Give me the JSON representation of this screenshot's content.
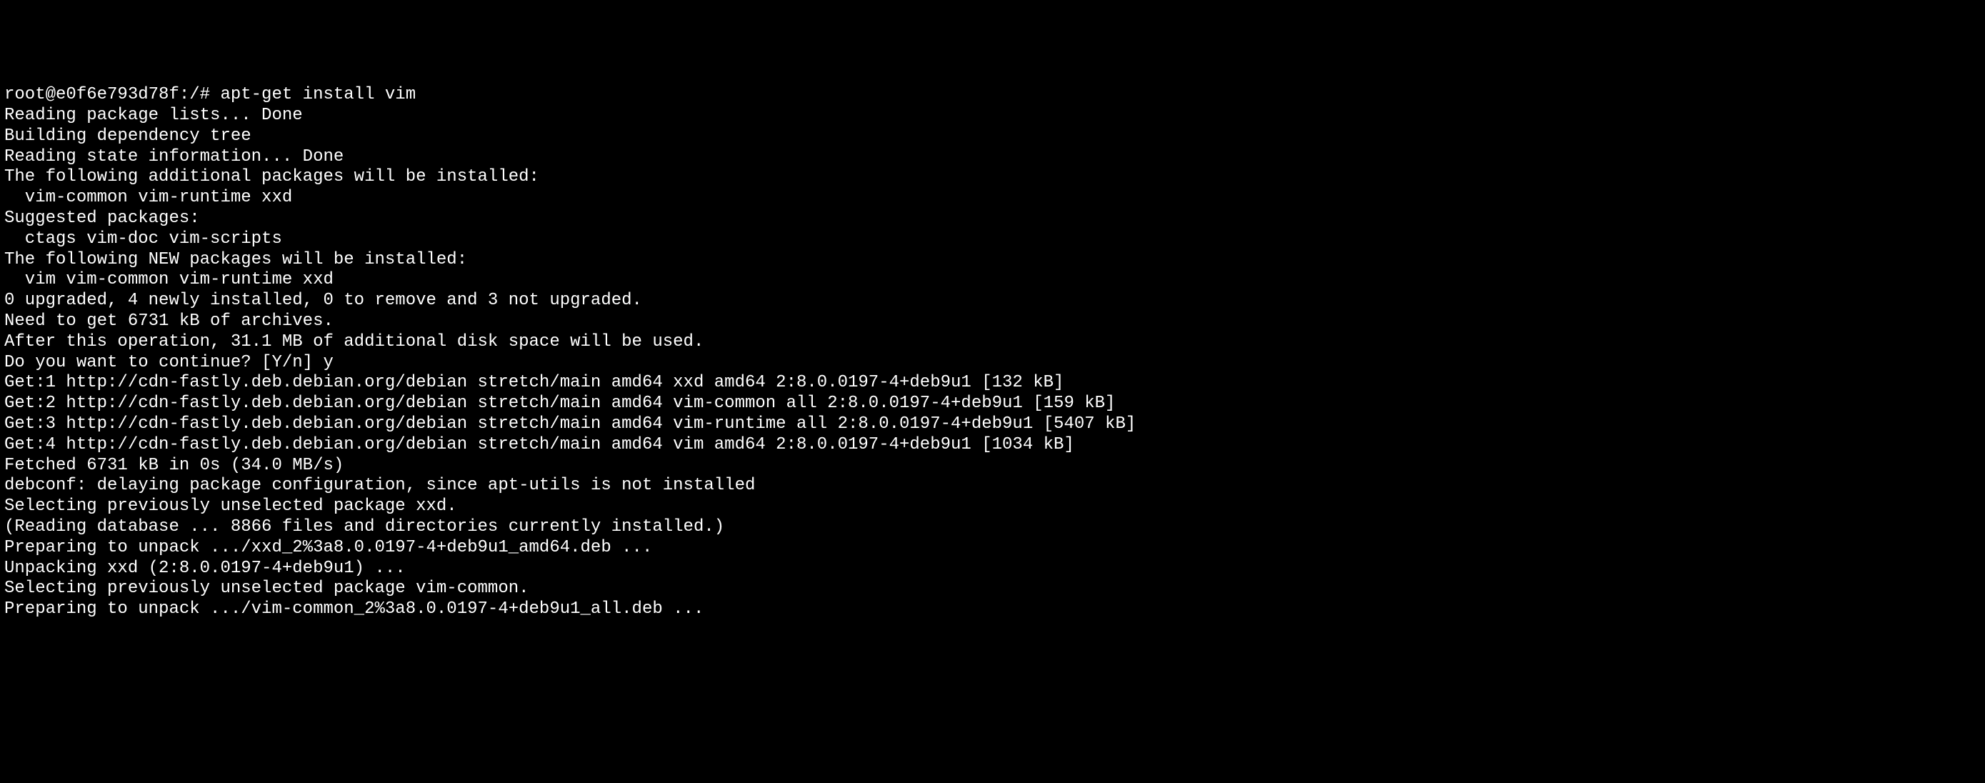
{
  "terminal": {
    "lines": [
      "root@e0f6e793d78f:/# apt-get install vim",
      "Reading package lists... Done",
      "Building dependency tree",
      "Reading state information... Done",
      "The following additional packages will be installed:",
      "  vim-common vim-runtime xxd",
      "Suggested packages:",
      "  ctags vim-doc vim-scripts",
      "The following NEW packages will be installed:",
      "  vim vim-common vim-runtime xxd",
      "0 upgraded, 4 newly installed, 0 to remove and 3 not upgraded.",
      "Need to get 6731 kB of archives.",
      "After this operation, 31.1 MB of additional disk space will be used.",
      "Do you want to continue? [Y/n] y",
      "Get:1 http://cdn-fastly.deb.debian.org/debian stretch/main amd64 xxd amd64 2:8.0.0197-4+deb9u1 [132 kB]",
      "Get:2 http://cdn-fastly.deb.debian.org/debian stretch/main amd64 vim-common all 2:8.0.0197-4+deb9u1 [159 kB]",
      "Get:3 http://cdn-fastly.deb.debian.org/debian stretch/main amd64 vim-runtime all 2:8.0.0197-4+deb9u1 [5407 kB]",
      "Get:4 http://cdn-fastly.deb.debian.org/debian stretch/main amd64 vim amd64 2:8.0.0197-4+deb9u1 [1034 kB]",
      "Fetched 6731 kB in 0s (34.0 MB/s)",
      "debconf: delaying package configuration, since apt-utils is not installed",
      "Selecting previously unselected package xxd.",
      "(Reading database ... 8866 files and directories currently installed.)",
      "Preparing to unpack .../xxd_2%3a8.0.0197-4+deb9u1_amd64.deb ...",
      "Unpacking xxd (2:8.0.0197-4+deb9u1) ...",
      "Selecting previously unselected package vim-common.",
      "Preparing to unpack .../vim-common_2%3a8.0.0197-4+deb9u1_all.deb ..."
    ]
  }
}
